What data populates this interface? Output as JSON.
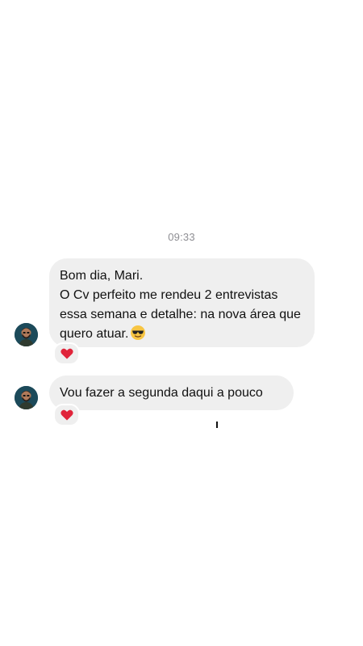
{
  "chat": {
    "timestamp": "09:33",
    "messages": [
      {
        "greeting": "Bom dia, Mari.",
        "body": "O Cv perfeito me rendeu 2 entrevistas essa semana e detalhe: na nova área que quero atuar.",
        "emoji": "sunglasses-emoji",
        "reaction": "heart-icon"
      },
      {
        "text": "Vou fazer a segunda daqui a pouco",
        "reaction": "heart-icon"
      }
    ]
  },
  "colors": {
    "bubble": "#efefef",
    "timestamp": "#8e8e93",
    "heart": "#e0243a",
    "avatar_bg": "#1c4a5a"
  }
}
